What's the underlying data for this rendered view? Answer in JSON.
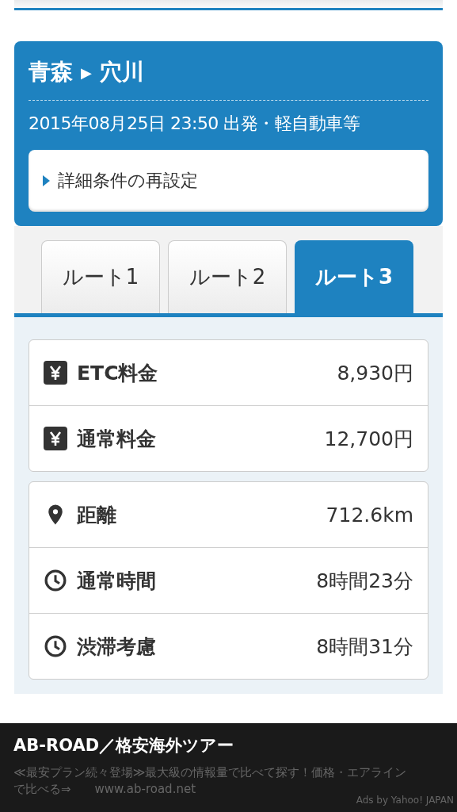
{
  "route": {
    "from": "青森",
    "to": "穴川",
    "arrow": "▶"
  },
  "conditions": "2015年08月25日 23:50 出発・軽自動車等",
  "reset_button": {
    "label": "詳細条件の再設定"
  },
  "tabs": [
    {
      "label": "ルート1",
      "selected": false
    },
    {
      "label": "ルート2",
      "selected": false
    },
    {
      "label": "ルート3",
      "selected": true
    }
  ],
  "groups": [
    {
      "rows": [
        {
          "kind": "yen",
          "label": "ETC料金",
          "value": "8,930円"
        },
        {
          "kind": "yen",
          "label": "通常料金",
          "value": "12,700円"
        }
      ]
    },
    {
      "rows": [
        {
          "kind": "pin",
          "label": "距離",
          "value": "712.6km"
        },
        {
          "kind": "clock",
          "label": "通常時間",
          "value": "8時間23分"
        },
        {
          "kind": "clock",
          "label": "渋滞考慮",
          "value": "8時間31分"
        }
      ]
    }
  ],
  "ad": {
    "title": "AB-ROAD／格安海外ツアー",
    "description": "≪最安プラン続々登場≫最大級の情報量で比べて探す！価格・エアラインで比べる⇒",
    "url": "www.ab-road.net",
    "credit": "Ads by Yahoo! JAPAN"
  }
}
